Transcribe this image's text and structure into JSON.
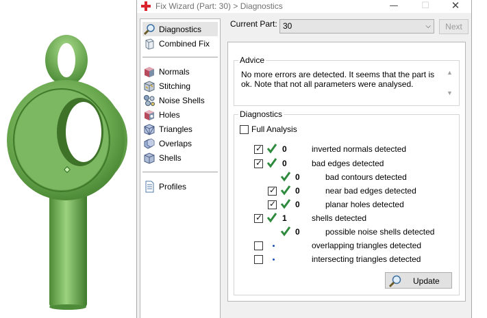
{
  "window": {
    "title": "Fix Wizard (Part: 30) > Diagnostics",
    "minimize_glyph": "—",
    "maximize_glyph": "☐",
    "close_glyph": "✕"
  },
  "nav": {
    "items": [
      {
        "label": "Diagnostics",
        "icon": "magnifier-icon",
        "selected": true
      },
      {
        "label": "Combined Fix",
        "icon": "cube-outline-icon",
        "selected": false
      },
      {
        "label": "Normals",
        "icon": "normals-cube-icon",
        "selected": false
      },
      {
        "label": "Stitching",
        "icon": "stitching-cube-icon",
        "selected": false
      },
      {
        "label": "Noise Shells",
        "icon": "noise-shells-icon",
        "selected": false
      },
      {
        "label": "Holes",
        "icon": "holes-cube-icon",
        "selected": false
      },
      {
        "label": "Triangles",
        "icon": "triangles-cube-icon",
        "selected": false
      },
      {
        "label": "Overlaps",
        "icon": "overlaps-icon",
        "selected": false
      },
      {
        "label": "Shells",
        "icon": "shells-icon",
        "selected": false
      },
      {
        "label": "Profiles",
        "icon": "document-icon",
        "selected": false
      }
    ]
  },
  "current_part": {
    "label": "Current Part:",
    "value": "30",
    "next_label": "Next"
  },
  "advice": {
    "title": "Advice",
    "text": "No more errors are detected. It seems that the part is ok. Note that not all parameters were analysed."
  },
  "diagnostics": {
    "title": "Diagnostics",
    "full_analysis_label": "Full Analysis",
    "full_analysis_checked": false,
    "update_label": "Update",
    "rows": [
      {
        "checked": true,
        "status": "ok",
        "count": "0",
        "label": "inverted normals detected"
      },
      {
        "checked": true,
        "status": "ok",
        "count": "0",
        "label": "bad edges detected"
      },
      {
        "checked": null,
        "status": "ok",
        "count": "0",
        "label": "bad contours detected"
      },
      {
        "checked": true,
        "status": "ok",
        "count": "0",
        "label": "near bad edges detected"
      },
      {
        "checked": true,
        "status": "ok",
        "count": "0",
        "label": "planar holes detected"
      },
      {
        "checked": true,
        "status": "ok",
        "count": "1",
        "label": "shells detected"
      },
      {
        "checked": null,
        "status": "ok",
        "count": "0",
        "label": "possible noise shells detected"
      },
      {
        "checked": false,
        "status": "pending",
        "count": "",
        "label": "overlapping triangles detected"
      },
      {
        "checked": false,
        "status": "pending",
        "count": "",
        "label": "intersecting triangles detected"
      }
    ]
  },
  "colors": {
    "model_green": "#6aa84f",
    "check_green": "#2e8b3e",
    "pending_blue": "#1b4fbf"
  }
}
